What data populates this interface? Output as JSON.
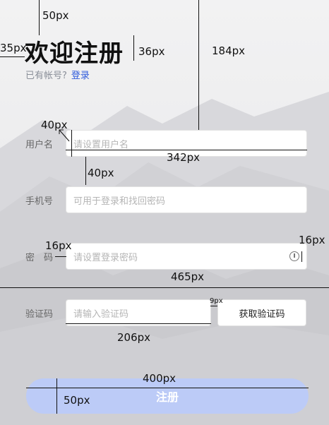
{
  "header": {
    "title": "欢迎注册",
    "subtitle": "已有帐号?",
    "login_link": "登录"
  },
  "form": {
    "username": {
      "label": "用户名",
      "placeholder": "请设置用户名"
    },
    "phone": {
      "label": "手机号",
      "placeholder": "可用于登录和找回密码"
    },
    "password": {
      "label": "密　码",
      "placeholder": "请设置登录密码"
    },
    "code": {
      "label": "验证码",
      "placeholder": "请输入验证码",
      "button": "获取验证码"
    },
    "submit": "注册"
  },
  "annotations": {
    "a1": "50px",
    "a2": "35px",
    "a3": "36px",
    "a4": "184px",
    "a5": "40px",
    "a6": "342px",
    "a7": "40px",
    "a8": "16px",
    "a9": "16px",
    "a10": "465px",
    "a11": "9px",
    "a12": "206px",
    "a13": "400px",
    "a14": "50px"
  }
}
